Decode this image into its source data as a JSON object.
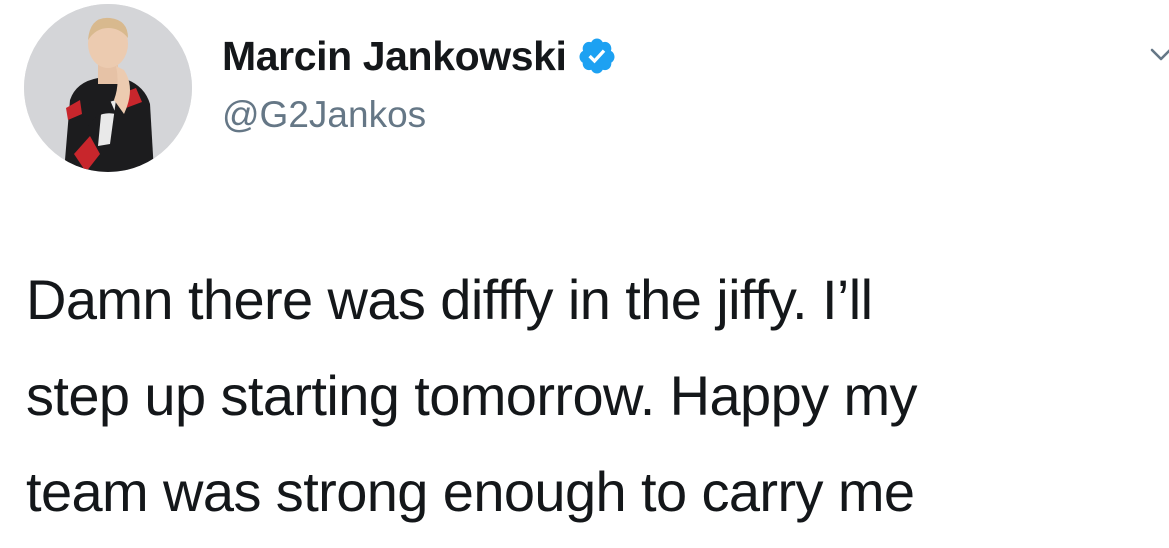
{
  "author": {
    "display_name": "Marcin Jankowski",
    "handle": "@G2Jankos",
    "verified": true,
    "verified_icon": "verified-badge-icon",
    "verified_color": "#1da1f2"
  },
  "menu": {
    "icon": "chevron-down-icon"
  },
  "tweet": {
    "lines": [
      "Damn there was difffy in the jiffy. I’ll",
      "step up starting tomorrow. Happy my",
      "team was strong enough to carry me"
    ]
  },
  "colors": {
    "text": "#14171a",
    "secondary": "#657786",
    "background": "#ffffff"
  }
}
